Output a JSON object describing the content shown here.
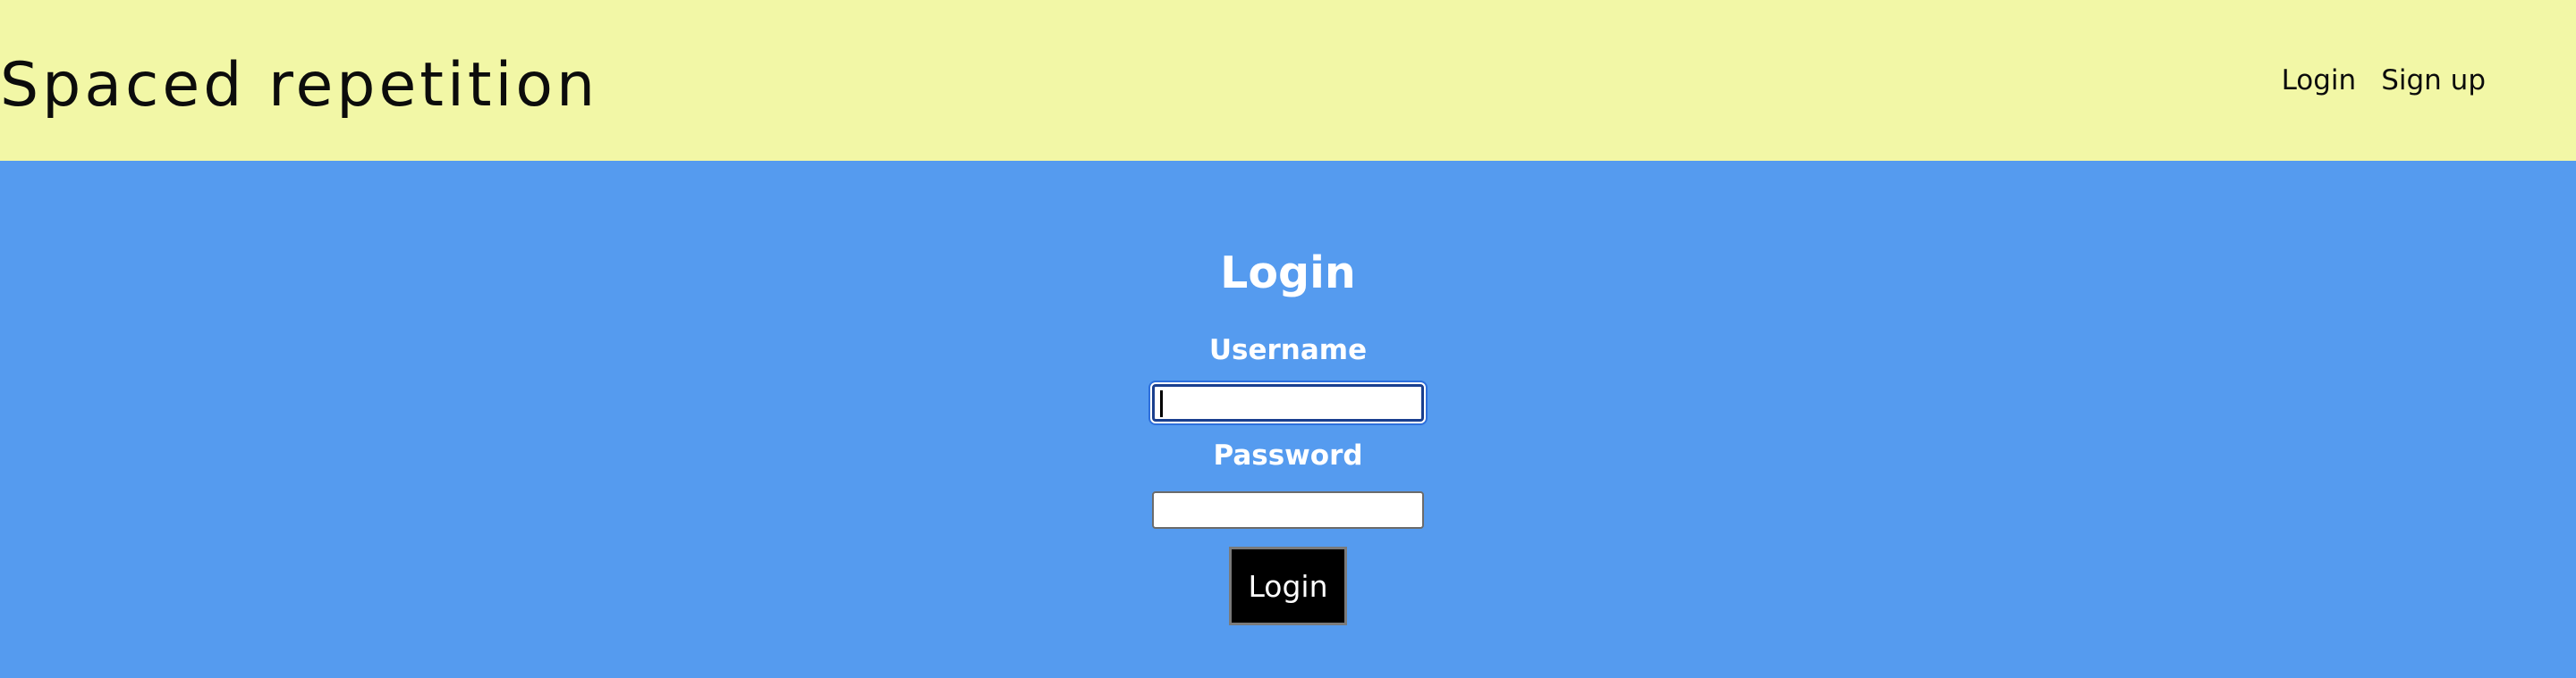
{
  "header": {
    "app_title": "Spaced repetition",
    "nav": {
      "login_label": "Login",
      "signup_label": "Sign up"
    }
  },
  "login_form": {
    "title": "Login",
    "username_label": "Username",
    "username_value": "",
    "password_label": "Password",
    "password_value": "",
    "submit_label": "Login"
  },
  "colors": {
    "header_bg": "#f2f7a6",
    "main_bg": "#559bef",
    "button_bg": "#000000",
    "text_light": "#ffffff",
    "text_dark": "#0c0c0c"
  }
}
